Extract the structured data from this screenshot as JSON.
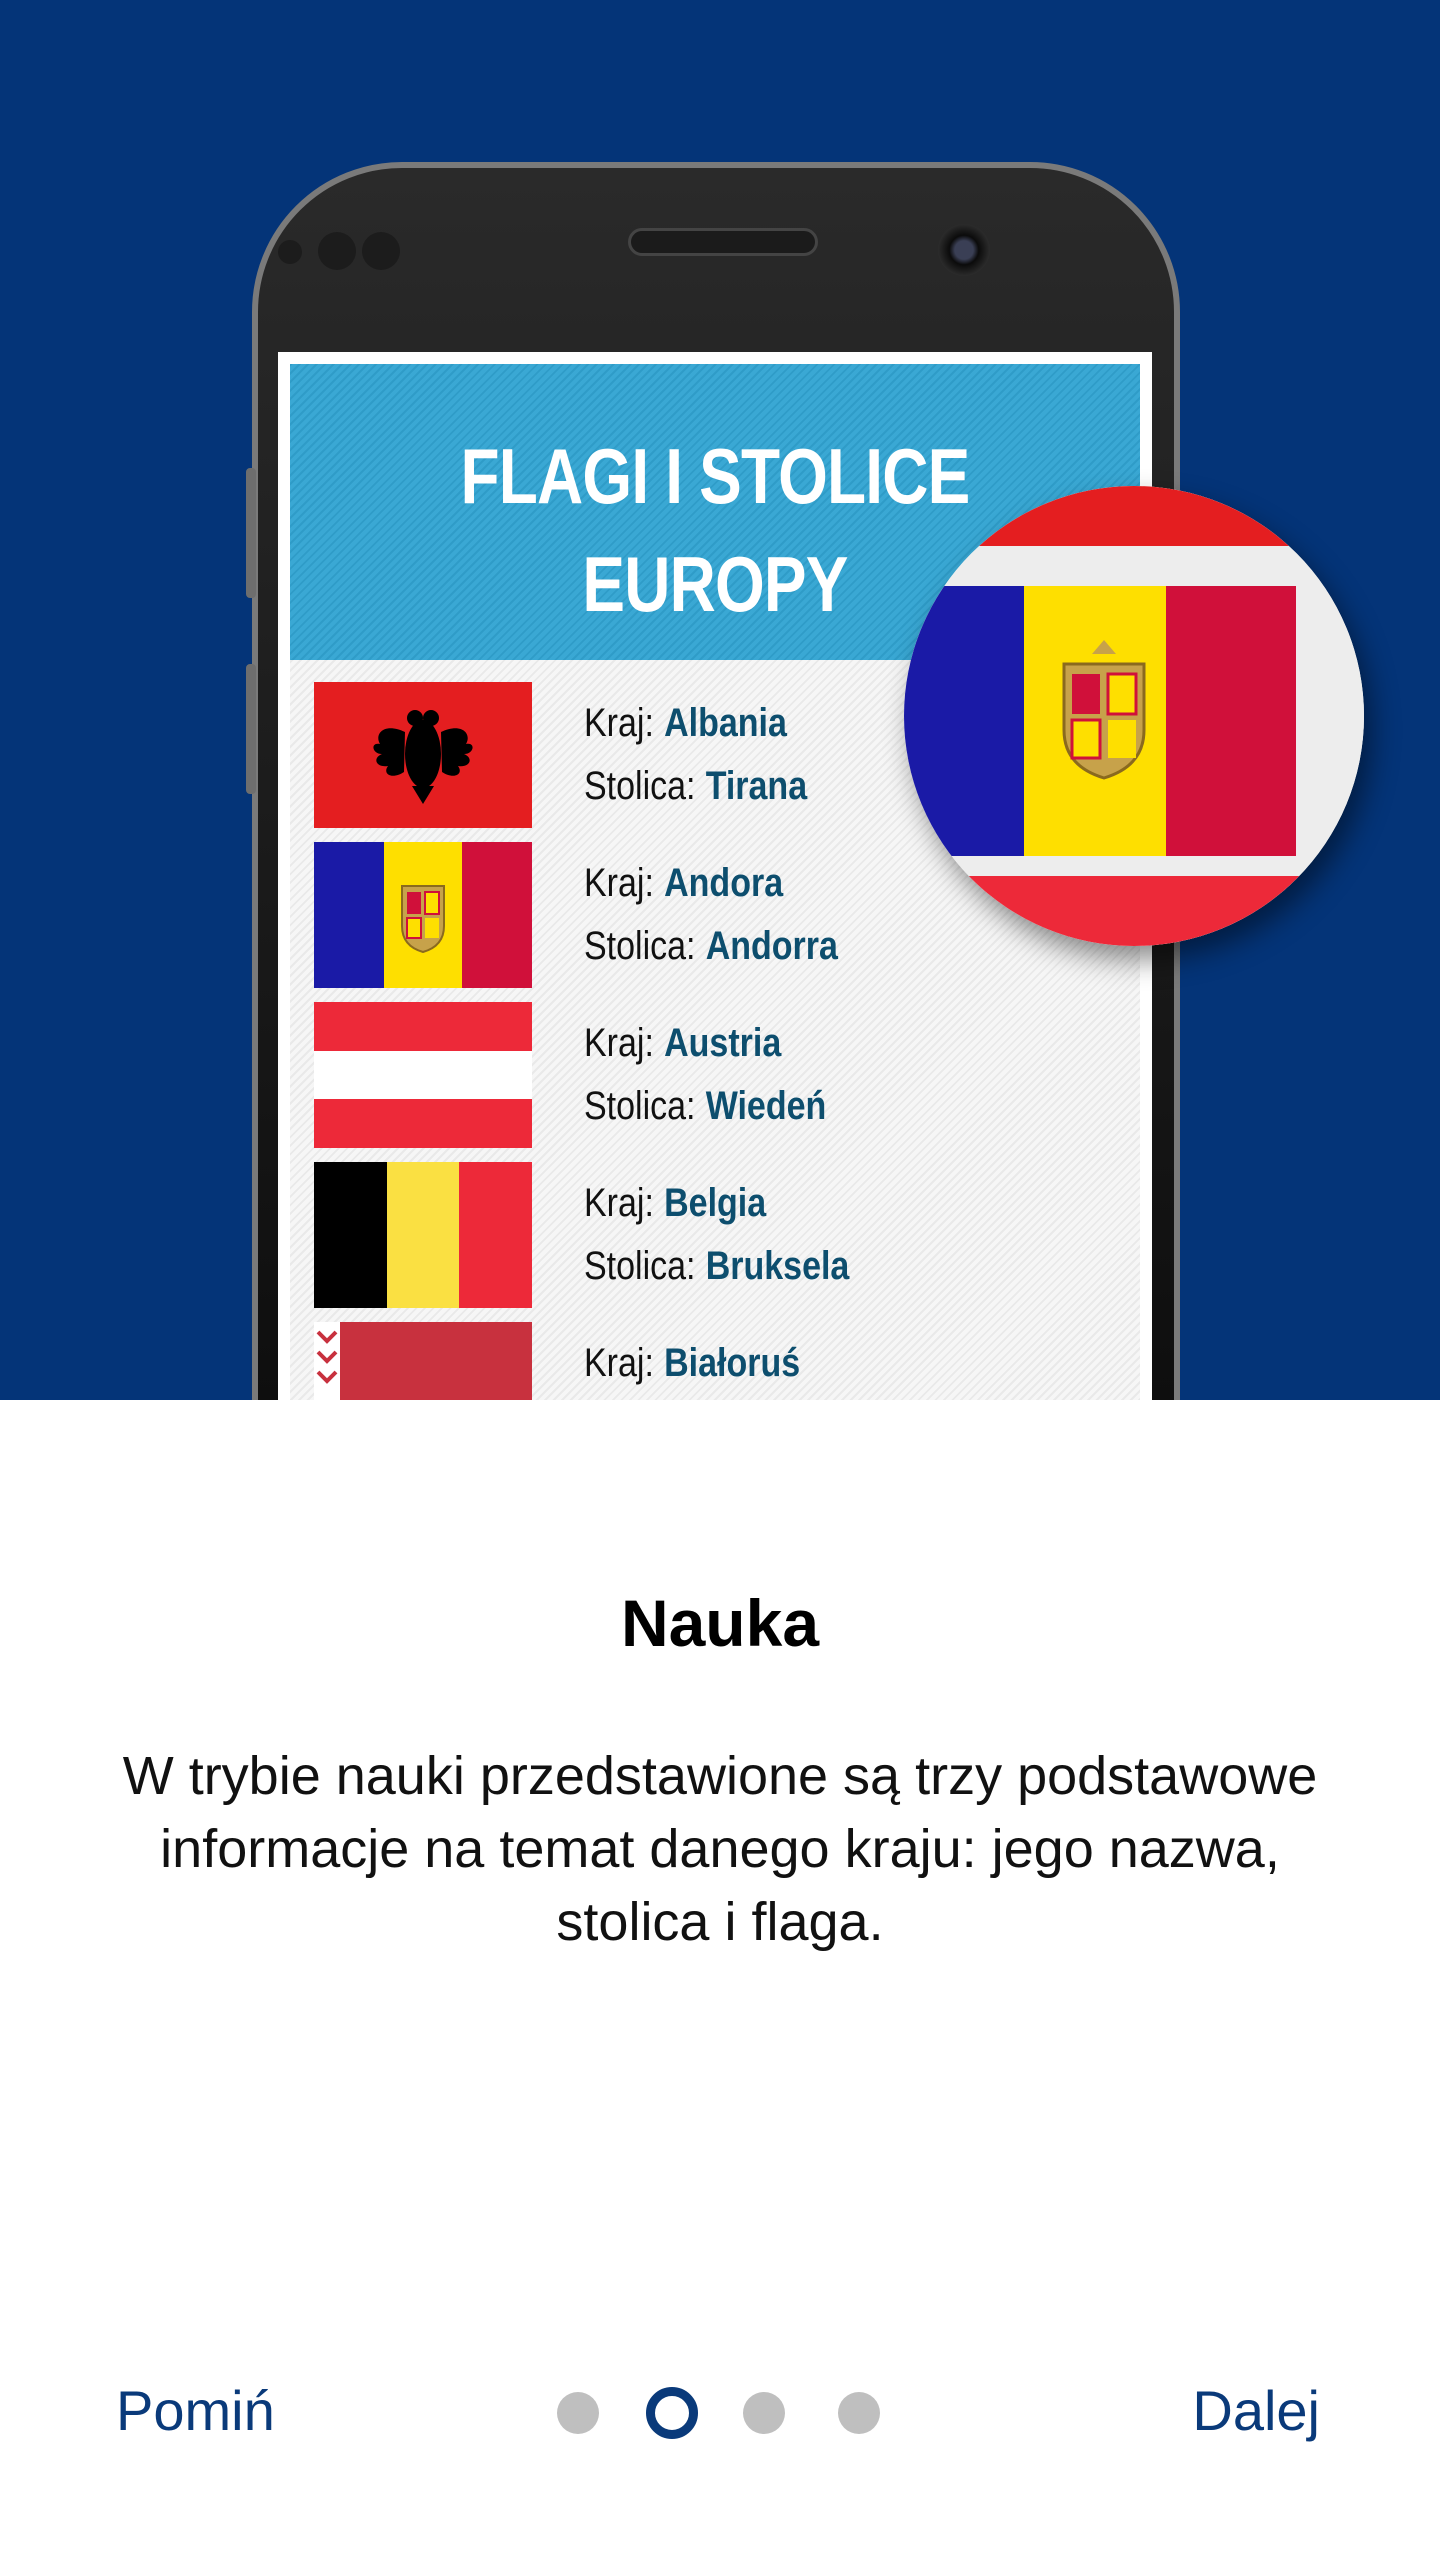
{
  "banner": {
    "line1": "FLAGI I STOLICE",
    "line2": "EUROPY"
  },
  "labels": {
    "country": "Kraj:",
    "capital": "Stolica:"
  },
  "rows": [
    {
      "country": "Albania",
      "capital": "Tirana",
      "flag": "albania-flag"
    },
    {
      "country": "Andora",
      "capital": "Andorra",
      "flag": "andorra-flag"
    },
    {
      "country": "Austria",
      "capital": "Wiedeń",
      "flag": "austria-flag"
    },
    {
      "country": "Belgia",
      "capital": "Bruksela",
      "flag": "belgium-flag"
    },
    {
      "country": "Białoruś",
      "capital": "",
      "flag": "belarus-flag"
    }
  ],
  "slide": {
    "title": "Nauka",
    "description": "W trybie nauki przedstawione są trzy podstawowe informacje na temat danego kraju: jego nazwa, stolica i flaga."
  },
  "footer": {
    "skip_label": "Pomiń",
    "next_label": "Dalej"
  },
  "pager": {
    "count": 4,
    "active_index": 1
  },
  "colors": {
    "hero_bg": "#043478",
    "banner_bg": "#3aa8d4",
    "accent": "#0a3a7a",
    "capital_text": "#0d4e6e"
  }
}
